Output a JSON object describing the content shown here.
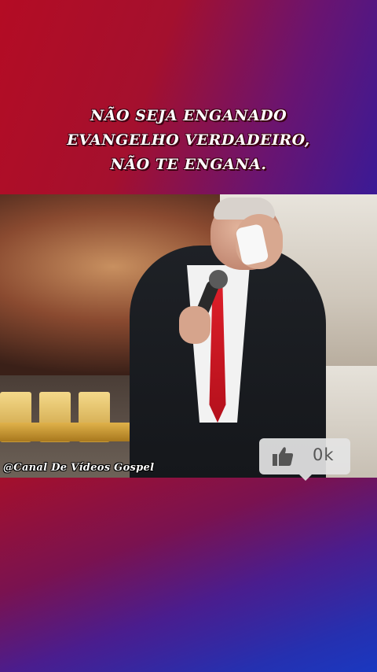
{
  "caption": {
    "lines": [
      "NÃO SEJA ENGANADO",
      "EVANGELHO VERDADEIRO,",
      "NÃO TE ENGANA."
    ]
  },
  "video": {
    "watermark": "@Canal De Vídeos Gospel"
  },
  "like": {
    "icon": "thumbs-up-icon",
    "count": "0k"
  },
  "colors": {
    "gradient_red": "#b40c24",
    "gradient_blue": "#1a38c0",
    "tie_red": "#e0202a",
    "like_bg": "#e4e4e4"
  }
}
